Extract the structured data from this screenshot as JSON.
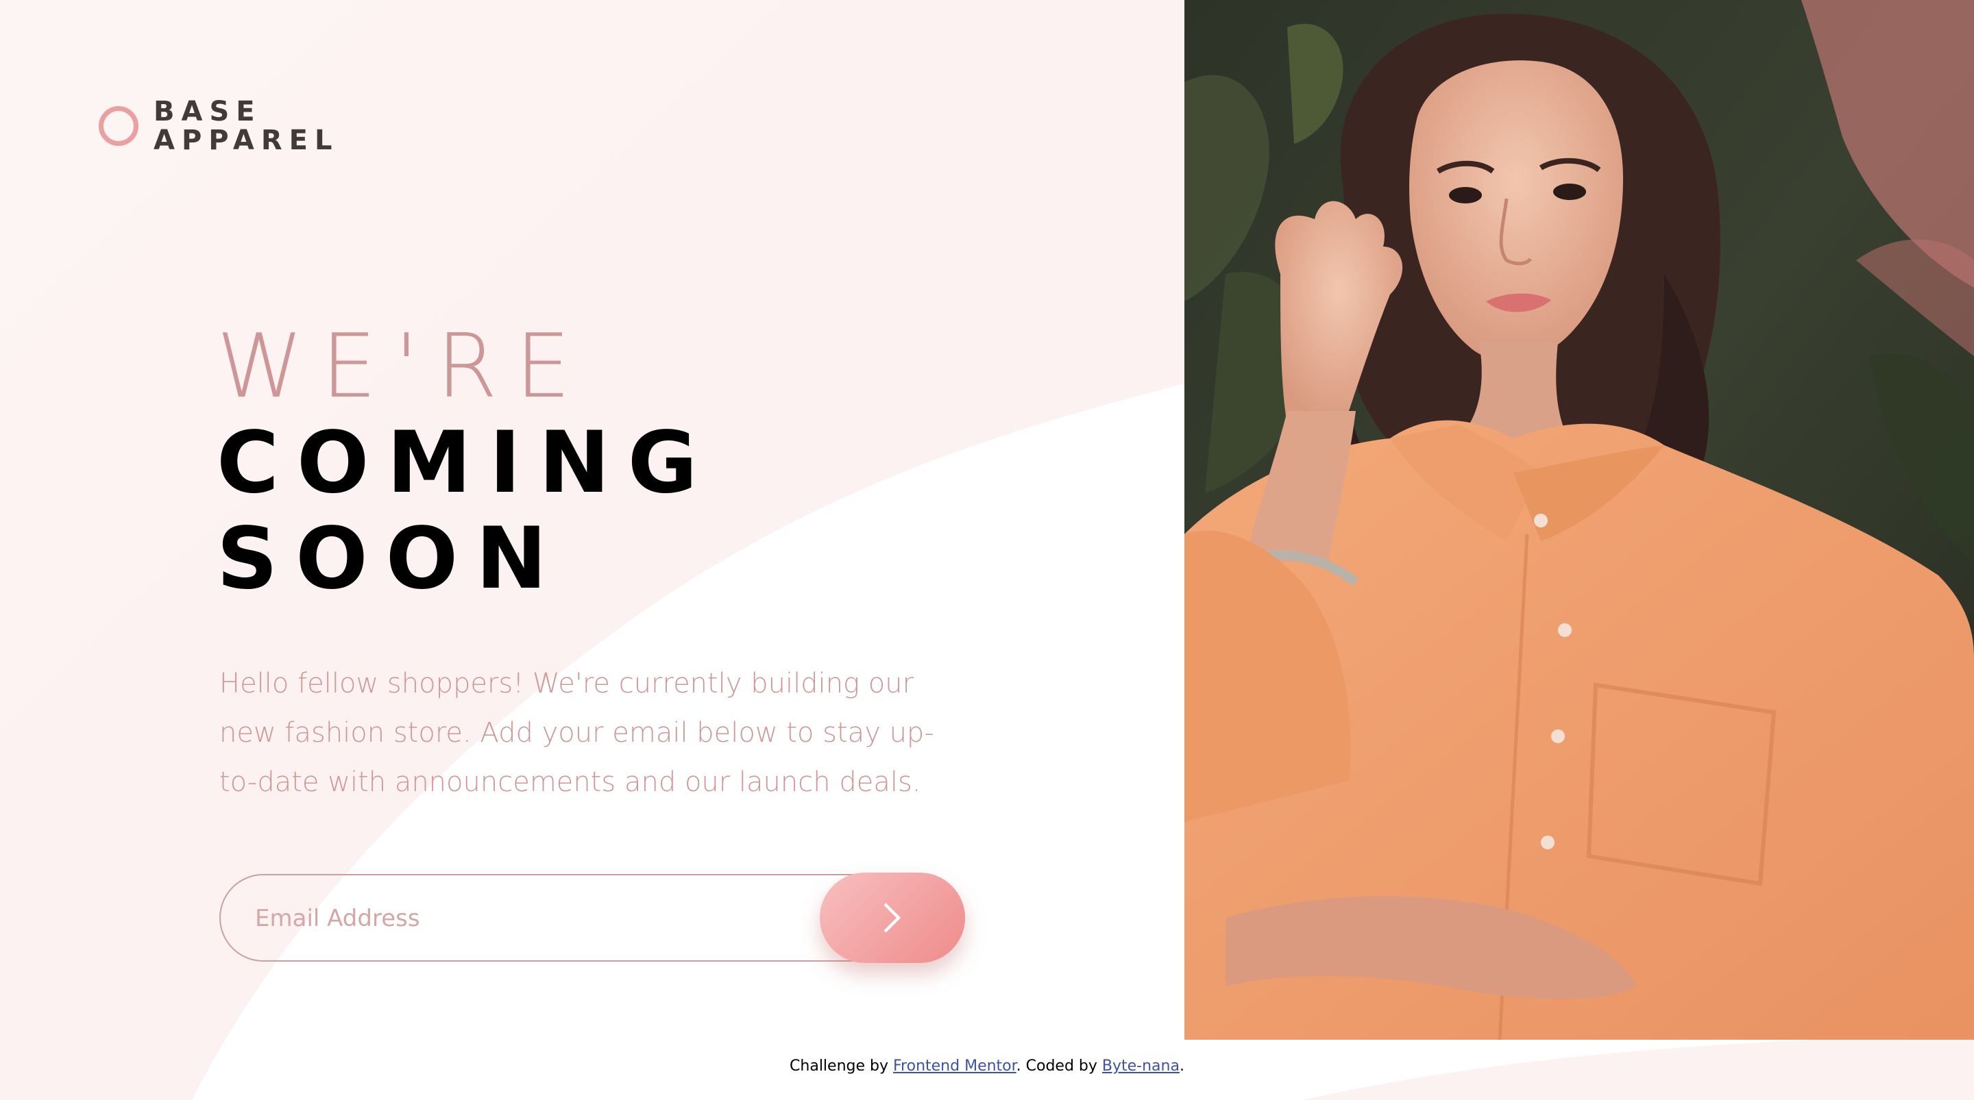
{
  "brand": {
    "line1": "BASE",
    "line2": "APPAREL",
    "ring_color": "#eb9f9f"
  },
  "hero": {
    "line1": "WE'RE",
    "line2": "COMING",
    "line3": "SOON"
  },
  "intro": "Hello fellow shoppers! We're currently building our new fashion store. Add your email below to stay up-to-date with announcements and our launch deals.",
  "form": {
    "email_placeholder": "Email Address",
    "submit_icon": "chevron-right-icon"
  },
  "footer": {
    "prefix": "Challenge by ",
    "link1": "Frontend Mentor",
    "middle": ". Coded by ",
    "link2": "Byte-nana",
    "suffix": "."
  },
  "colors": {
    "accent": "#ce9797",
    "button_start": "#f8bfbf",
    "button_end": "#ee8b8b",
    "dark": "#423a3a"
  }
}
